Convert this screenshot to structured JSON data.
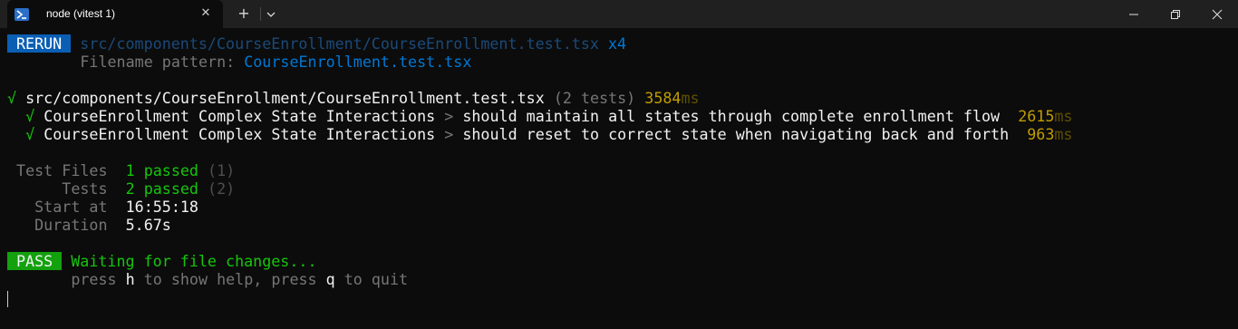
{
  "window": {
    "tab_title": "node (vitest 1)",
    "tab_icon": "powershell-icon",
    "close_tab_icon": "close-icon",
    "new_tab_label": "+",
    "dropdown_icon": "chevron-down-icon"
  },
  "terminal": {
    "rerun_badge": "RERUN",
    "rerun_path": "src/components/CourseEnrollment/CourseEnrollment.test.tsx",
    "rerun_count": "x4",
    "filename_label": "Filename pattern:",
    "filename_value": "CourseEnrollment.test.tsx",
    "suite_check": "√",
    "suite_path": "src/components/CourseEnrollment/CourseEnrollment.test.tsx",
    "suite_count": "(2 tests)",
    "suite_time_value": "3584",
    "suite_time_unit": "ms",
    "tests": [
      {
        "check": "√",
        "suite": "CourseEnrollment Complex State Interactions",
        "sep": ">",
        "name": "should maintain all states through complete enrollment flow",
        "time_value": "2615",
        "time_unit": "ms"
      },
      {
        "check": "√",
        "suite": "CourseEnrollment Complex State Interactions",
        "sep": ">",
        "name": "should reset to correct state when navigating back and forth",
        "time_value": "963",
        "time_unit": "ms"
      }
    ],
    "summary": {
      "test_files_label": "Test Files",
      "test_files_passed": "1 passed",
      "test_files_total": "(1)",
      "tests_label": "Tests",
      "tests_passed": "2 passed",
      "tests_total": "(2)",
      "start_label": "Start at",
      "start_value": "16:55:18",
      "duration_label": "Duration",
      "duration_value": "5.67s"
    },
    "pass_badge": "PASS",
    "waiting_text": "Waiting for file changes...",
    "help_press1": "press",
    "help_key_h": "h",
    "help_mid": "to show help, press",
    "help_key_q": "q",
    "help_end": "to quit"
  },
  "colors": {
    "background": "#0c0c0c",
    "titlebar": "#202020",
    "pass_badge": "#13a10e",
    "rerun_badge": "#0a5fb4",
    "ok_green": "#16c60c",
    "time_yellow": "#c19c00"
  }
}
